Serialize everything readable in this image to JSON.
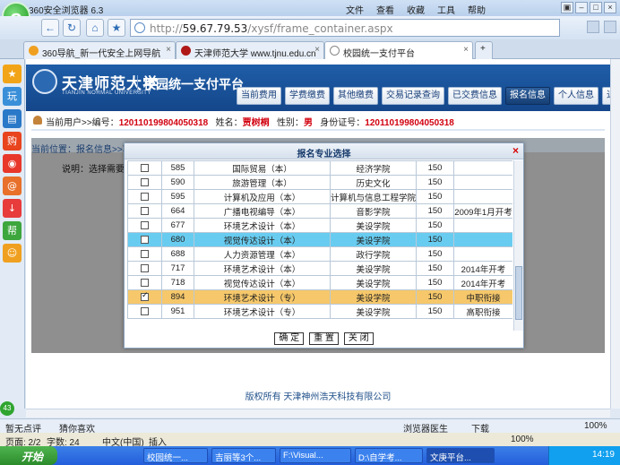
{
  "browser": {
    "app_title": "360安全浏览器 6.3",
    "menu": [
      "文件",
      "查看",
      "收藏",
      "工具",
      "帮助"
    ],
    "url_prefix": "http://",
    "url_host": "59.67.79.53",
    "url_path": "/xysf/frame_container.aspx",
    "tabs": [
      {
        "label": "360导航_新一代安全上网导航",
        "icon_color": "#f0a020",
        "active": false
      },
      {
        "label": "天津师范大学 www.tjnu.edu.cn",
        "icon_color": "#b01818",
        "active": false
      },
      {
        "label": "校园统一支付平台",
        "icon_color": "#ffffff",
        "active": true
      }
    ]
  },
  "sidebar_tools": [
    {
      "name": "star-icon",
      "glyph": "★",
      "color": "#f2a418"
    },
    {
      "name": "play-icon",
      "glyph": "玩",
      "color": "#3a8fd9"
    },
    {
      "name": "book-icon",
      "glyph": "▤",
      "color": "#2a78c8"
    },
    {
      "name": "shop-icon",
      "glyph": "购",
      "color": "#e8441e"
    },
    {
      "name": "weibo-icon",
      "glyph": "◉",
      "color": "#e8382b"
    },
    {
      "name": "mail-icon",
      "glyph": "@",
      "color": "#e8702a"
    },
    {
      "name": "download-icon",
      "glyph": "↓",
      "color": "#e83b3b"
    },
    {
      "name": "help-icon",
      "glyph": "帮",
      "color": "#3da63d"
    },
    {
      "name": "smile-icon",
      "glyph": "☺",
      "color": "#f0a020"
    }
  ],
  "site": {
    "school_cn": "天津师范大学",
    "school_en": "TIANJIN NORMAL UNIVERSITY",
    "title": "校园统一支付平台",
    "nav": [
      {
        "label": "当前费用",
        "active": false
      },
      {
        "label": "学费缴费",
        "active": false
      },
      {
        "label": "其他缴费",
        "active": false
      },
      {
        "label": "交易记录查询",
        "active": false
      },
      {
        "label": "已交费信息",
        "active": false
      },
      {
        "label": "报名信息",
        "active": true
      },
      {
        "label": "个人信息",
        "active": false
      },
      {
        "label": "退出登陆",
        "active": false
      }
    ],
    "userbar": {
      "current_user": "当前用户>>编号：",
      "user_id": "120110199804050318",
      "name_label": "姓名：",
      "name": "贾树桐",
      "gender_label": "性别：",
      "gender": "男",
      "idcard_label": "身份证号：",
      "idcard": "120110199804050318"
    },
    "crumb": "当前位置：报名信息>>项",
    "explain": "说明：选择需要报名",
    "footer": "版权所有 天津神州浩天科技有限公司"
  },
  "modal": {
    "title": "报名专业选择",
    "rows": [
      {
        "checked": false,
        "code": "585",
        "name": "国际贸易（本）",
        "college": "经济学院",
        "fee": "150",
        "note": "",
        "hl": ""
      },
      {
        "checked": false,
        "code": "590",
        "name": "旅游管理（本）",
        "college": "历史文化",
        "fee": "150",
        "note": "",
        "hl": ""
      },
      {
        "checked": false,
        "code": "595",
        "name": "计算机及应用（本）",
        "college": "计算机与信息工程学院",
        "fee": "150",
        "note": "",
        "hl": ""
      },
      {
        "checked": false,
        "code": "664",
        "name": "广播电视编导（本）",
        "college": "音影学院",
        "fee": "150",
        "note": "2009年1月开考",
        "hl": ""
      },
      {
        "checked": false,
        "code": "677",
        "name": "环境艺术设计（本）",
        "college": "美设学院",
        "fee": "150",
        "note": "",
        "hl": ""
      },
      {
        "checked": false,
        "code": "680",
        "name": "视觉传达设计（本）",
        "college": "美设学院",
        "fee": "150",
        "note": "",
        "hl": "blue"
      },
      {
        "checked": false,
        "code": "688",
        "name": "人力资源管理（本）",
        "college": "政行学院",
        "fee": "150",
        "note": "",
        "hl": ""
      },
      {
        "checked": false,
        "code": "717",
        "name": "环境艺术设计（本）",
        "college": "美设学院",
        "fee": "150",
        "note": "2014年开考",
        "hl": ""
      },
      {
        "checked": false,
        "code": "718",
        "name": "视觉传达设计（本）",
        "college": "美设学院",
        "fee": "150",
        "note": "2014年开考",
        "hl": ""
      },
      {
        "checked": true,
        "code": "894",
        "name": "环境艺术设计（专）",
        "college": "美设学院",
        "fee": "150",
        "note": "中职衔接",
        "hl": "orange"
      },
      {
        "checked": false,
        "code": "951",
        "name": "环境艺术设计（专）",
        "college": "美设学院",
        "fee": "150",
        "note": "高职衔接",
        "hl": ""
      }
    ],
    "buttons": {
      "confirm": "确 定",
      "reset": "重 置",
      "close": "关 闭"
    }
  },
  "statusbar": {
    "review": "暂无点评",
    "guess": "猜你喜欢",
    "doctor": "浏览器医生",
    "download": "下载",
    "zoom": "100%",
    "pages": "页面: 2/2",
    "words": "字数: 24",
    "lang": "中文(中国)",
    "insert": "插入",
    "zoom2": "100%",
    "badge": "43"
  },
  "taskbar": {
    "start": "开始",
    "tasks": [
      {
        "label": "校园统一...",
        "active": false
      },
      {
        "label": "吉丽等3个...",
        "active": false
      },
      {
        "label": "F:\\Visual...",
        "active": false
      },
      {
        "label": "D:\\自学考...",
        "active": false
      },
      {
        "label": "文庚平台...",
        "active": true
      }
    ],
    "time": "14:19"
  }
}
